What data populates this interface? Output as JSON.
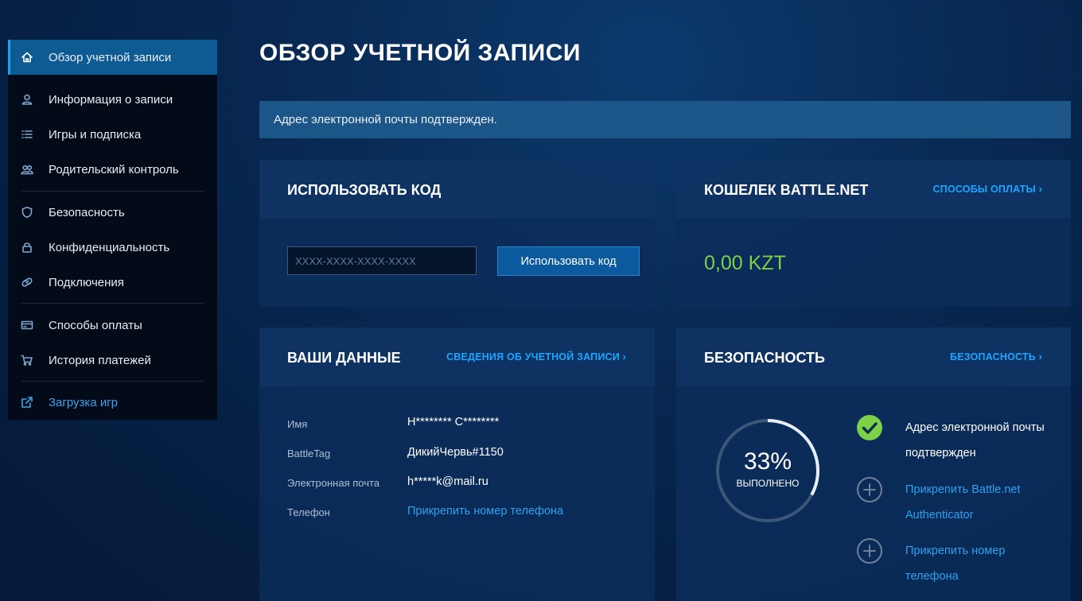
{
  "sidebar": {
    "items": [
      {
        "label": "Обзор учетной записи",
        "icon": "home-icon"
      },
      {
        "label": "Информация о записи",
        "icon": "user-icon"
      },
      {
        "label": "Игры и подписка",
        "icon": "list-icon"
      },
      {
        "label": "Родительский контроль",
        "icon": "users-icon"
      },
      {
        "label": "Безопасность",
        "icon": "shield-icon"
      },
      {
        "label": "Конфиденциальность",
        "icon": "lock-icon"
      },
      {
        "label": "Подключения",
        "icon": "link-icon"
      },
      {
        "label": "Способы оплаты",
        "icon": "credit-card-icon"
      },
      {
        "label": "История платежей",
        "icon": "cart-icon"
      },
      {
        "label": "Загрузка игр",
        "icon": "external-link-icon"
      }
    ]
  },
  "page": {
    "title": "ОБЗОР УЧЕТНОЙ ЗАПИСИ",
    "alert": "Адрес электронной почты подтвержден."
  },
  "redeem": {
    "title": "ИСПОЛЬЗОВАТЬ КОД",
    "placeholder": "XXXX-XXXX-XXXX-XXXX",
    "button": "Использовать код"
  },
  "wallet": {
    "title": "КОШЕЛЕК BATTLE.NET",
    "link": "СПОСОБЫ ОПЛАТЫ ›",
    "amount": "0,00 KZT",
    "amount_color": "#7cd146"
  },
  "details": {
    "title": "ВАШИ ДАННЫЕ",
    "link": "СВЕДЕНИЯ ОБ УЧЕТНОЙ ЗАПИСИ ›",
    "rows": [
      {
        "label": "Имя",
        "value": "Н******** С********"
      },
      {
        "label": "BattleTag",
        "value": "ДикийЧервь#1150"
      },
      {
        "label": "Электронная почта",
        "value": "h*****k@mail.ru"
      },
      {
        "label": "Телефон",
        "value": "Прикрепить номер телефона"
      }
    ]
  },
  "security": {
    "title": "БЕЗОПАСНОСТЬ",
    "link": "БЕЗОПАСНОСТЬ ›",
    "percent_text": "33%",
    "percent_value": 33,
    "percent_label": "ВЫПОЛНЕНО",
    "items": [
      {
        "line1": "Адрес электронной почты",
        "line2": "подтвержден",
        "status": "done",
        "icon": "check-circle-icon"
      },
      {
        "line1": "Прикрепить Battle.net",
        "line2": "Authenticator",
        "status": "todo",
        "icon": "plus-circle-icon"
      },
      {
        "line1": "Прикрепить номер",
        "line2": "телефона",
        "status": "todo",
        "icon": "plus-circle-icon"
      }
    ]
  },
  "colors": {
    "accent": "#1ea6ff",
    "sidebar_active": "#0e5a92",
    "success": "#7cd146"
  }
}
